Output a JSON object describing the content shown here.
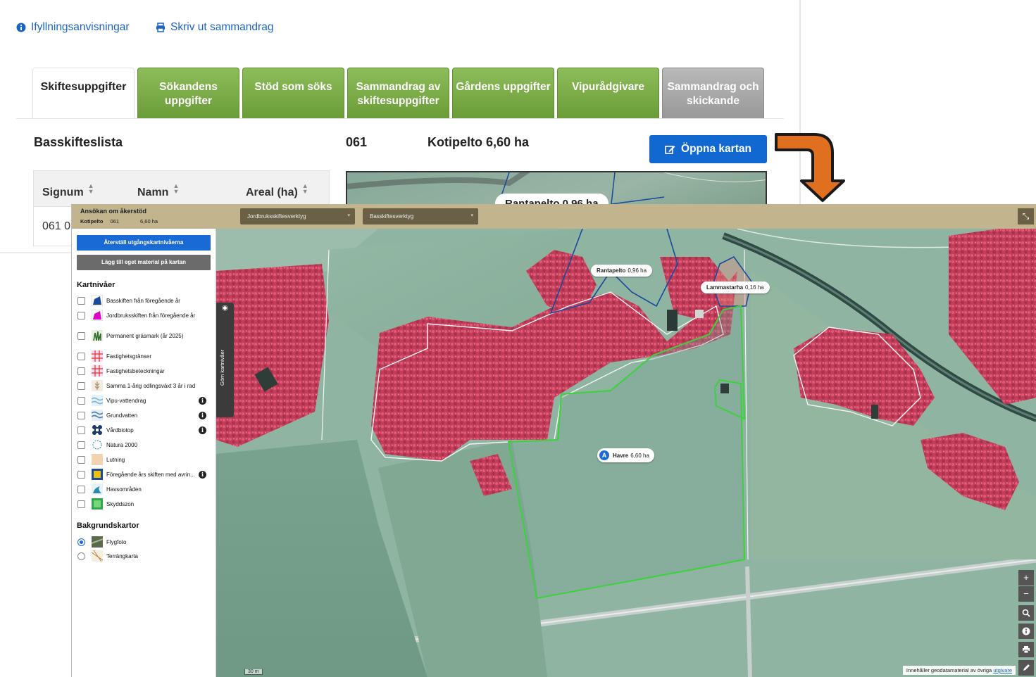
{
  "top_links": {
    "instructions": "Ifyllningsanvisningar",
    "print_summary": "Skriv ut sammandrag"
  },
  "tabs": [
    {
      "label": "Skiftesuppgifter",
      "state": "active"
    },
    {
      "label": "Sökandens uppgifter",
      "state": "enabled"
    },
    {
      "label": "Stöd som söks",
      "state": "enabled"
    },
    {
      "label": "Sammandrag av skiftesuppgifter",
      "state": "enabled"
    },
    {
      "label": "Gårdens uppgifter",
      "state": "enabled"
    },
    {
      "label": "Vipurådgivare",
      "state": "enabled"
    },
    {
      "label": "Sammandrag och skickande",
      "state": "disabled"
    }
  ],
  "form": {
    "list_title": "Basskifteslista",
    "field_code": "061",
    "field_name_area": "Kotipelto 6,60 ha",
    "open_map_button": "Öppna kartan",
    "table_headers": {
      "signum": "Signum",
      "name": "Namn",
      "area": "Areal (ha)"
    },
    "row_signum": "061 0",
    "preview_label": "Rantapelto 0,96 ha"
  },
  "map_app": {
    "title": "Ansökan om åkerstöd",
    "sub_name": "Kotipelto",
    "sub_code": "061",
    "sub_area": "6,60 ha",
    "dropdown_agri": "Jordbruksskiftesverktyg",
    "dropdown_base": "Basskiftesverktyg",
    "btn_reset": "Återställ utgångskartnivåerna",
    "btn_add": "Lägg till eget material på kartan",
    "layers_title": "Kartnivåer",
    "layers": [
      {
        "label": "Basskiften från föregående år",
        "icon": "base-parcels-icon",
        "color": "#1a4a9a",
        "info": false
      },
      {
        "label": "Jordbruksskiften från föregående år",
        "icon": "agri-parcels-icon",
        "color": "#e000c8",
        "info": false
      },
      {
        "label": "Permanent gräsmark (år 2025)",
        "icon": "grass-icon",
        "color": "#2f6b2a",
        "info": false
      },
      {
        "label": "Fastighetsgränser",
        "icon": "property-border-icon",
        "color": "#e03030",
        "info": false
      },
      {
        "label": "Fastighetsbeteckningar",
        "icon": "property-id-icon",
        "color": "#e03030",
        "info": false
      },
      {
        "label": "Samma 1-årig odlingsväxt 3 år i rad",
        "icon": "crop-rotation-icon",
        "color": "#b09070",
        "info": false
      },
      {
        "label": "Vipu-vattendrag",
        "icon": "waterway-icon",
        "color": "#7ab6e0",
        "info": true
      },
      {
        "label": "Grundvatten",
        "icon": "groundwater-icon",
        "color": "#4a7fb0",
        "info": true
      },
      {
        "label": "Vårdbiotop",
        "icon": "biotope-icon",
        "color": "#1a3a6a",
        "info": true
      },
      {
        "label": "Natura 2000",
        "icon": "natura-icon",
        "color": "#3aa0a0",
        "info": false
      },
      {
        "label": "Lutning",
        "icon": "slope-icon",
        "color": "#f3d2b0",
        "info": false
      },
      {
        "label": "Föregående års skiften med avrin...",
        "icon": "runoff-icon",
        "color": "#f0c000",
        "info": true
      },
      {
        "label": "Havsområden",
        "icon": "sea-icon",
        "color": "#2a8ab0",
        "info": false
      },
      {
        "label": "Skyddszon",
        "icon": "buffer-zone-icon",
        "color": "#2ea84a",
        "info": false
      }
    ],
    "bg_title": "Bakgrundskartor",
    "bg_maps": [
      {
        "label": "Flygfoto",
        "selected": true,
        "icon": "aerial-photo-icon"
      },
      {
        "label": "Terrängkarta",
        "selected": false,
        "icon": "terrain-map-icon"
      }
    ],
    "collapse_tab": "Göm kartnivåer",
    "map_labels": {
      "rantapelto_name": "Rantapelto",
      "rantapelto_area": "0,96 ha",
      "lammastarha_name": "Lammastarha",
      "lammastarha_area": "0,16 ha",
      "havre_badge": "A",
      "havre_name": "Havre",
      "havre_area": "6,60 ha"
    },
    "controls": {
      "zoom_in": "+",
      "zoom_out": "−"
    },
    "attribution": "Innehåller geodatamaterial av övriga",
    "attribution_link": "utgivare",
    "scale": "30 m"
  },
  "colors": {
    "link_blue": "#1a64c8",
    "tab_green": "#7aab48",
    "tab_grey": "#a6a6a6",
    "primary_button": "#1168d1",
    "map_header": "#c2b48c",
    "arrow_orange": "#e07020",
    "selected_parcel": "#3cd23c",
    "base_parcel": "#1a4a9a"
  }
}
